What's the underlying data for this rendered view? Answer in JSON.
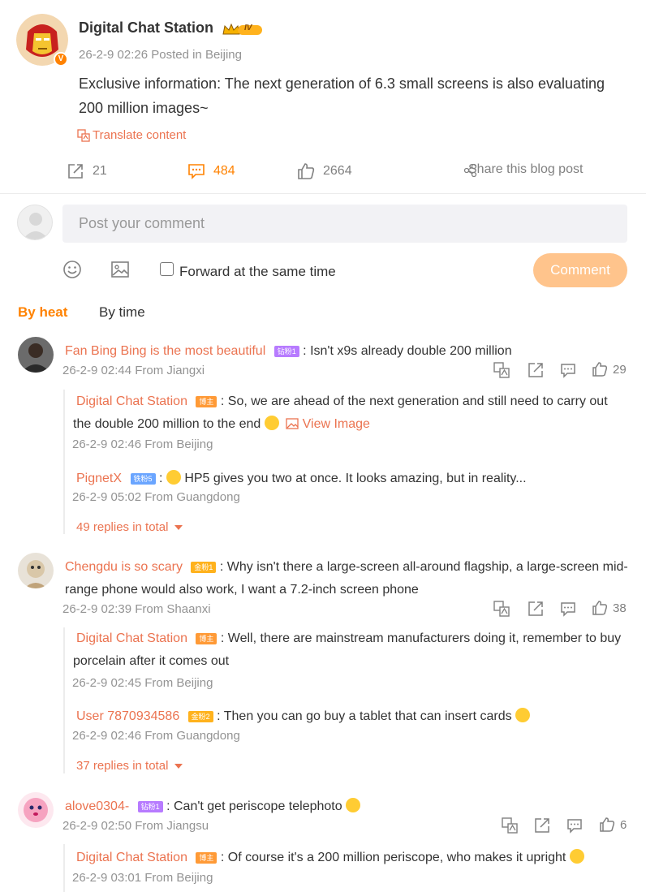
{
  "post": {
    "author": "Digital Chat Station",
    "author_level": "IV",
    "meta": "26-2-9 02:26  Posted in Beijing",
    "text": " Exclusive information: The next generation of 6.3 small screens is also evaluating 200 million images~",
    "translate_label": "Translate content",
    "repost_count": "21",
    "comment_count": "484",
    "like_count": "2664",
    "share_label": "Share this blog post"
  },
  "composer": {
    "placeholder": "Post your comment",
    "forward_label": "Forward at the same time",
    "submit_label": "Comment"
  },
  "sort": {
    "heat": "By heat",
    "time": "By time"
  },
  "comments": [
    {
      "name": "Fan Bing Bing is the most beautiful",
      "badge": "钻粉1",
      "text": "Isn't x9s already double 200 million",
      "meta": "26-2-9 02:44 From Jiangxi",
      "likes": "29",
      "replies": [
        {
          "name": "Digital Chat Station",
          "badge": "博主",
          "text": "So, we are ahead of the next generation and still need to carry out the double 200 million to the end",
          "view_image": "View Image",
          "meta": "26-2-9 02:46 From Beijing"
        },
        {
          "name": "PignetX",
          "badge": "铁粉5",
          "text": "HP5 gives you two at once. It looks amazing, but in reality...",
          "meta": "26-2-9 05:02 From Guangdong"
        }
      ],
      "more": "49 replies in total"
    },
    {
      "name": "Chengdu is so scary",
      "badge": "金粉1",
      "text": "Why isn't there a large-screen all-around flagship, a large-screen mid-range phone would also work, I want a 7.2-inch screen phone",
      "meta": "26-2-9 02:39 From Shaanxi",
      "likes": "38",
      "replies": [
        {
          "name": "Digital Chat Station",
          "badge": "博主",
          "text": "Well, there are mainstream manufacturers doing it, remember to buy porcelain after it comes out",
          "meta": "26-2-9 02:45 From Beijing"
        },
        {
          "name": "User 7870934586",
          "badge": "金粉2",
          "text": "Then you can go buy a tablet that can insert cards",
          "meta": "26-2-9 02:46 From Guangdong"
        }
      ],
      "more": "37 replies in total"
    },
    {
      "name": "alove0304-",
      "badge": "钻粉1",
      "text": "Can't get periscope telephoto",
      "meta": "26-2-9 02:50 From Jiangsu",
      "likes": "6",
      "replies": [
        {
          "name": "Digital Chat Station",
          "badge": "博主",
          "text": "Of course it's a 200 million periscope, who makes it upright",
          "meta": "26-2-9 03:01 From Beijing"
        }
      ]
    }
  ],
  "colors": {
    "accent": "#ff8200",
    "link": "#eb7350",
    "meta_gray": "#939393",
    "comment_button": "#ffc48c"
  }
}
